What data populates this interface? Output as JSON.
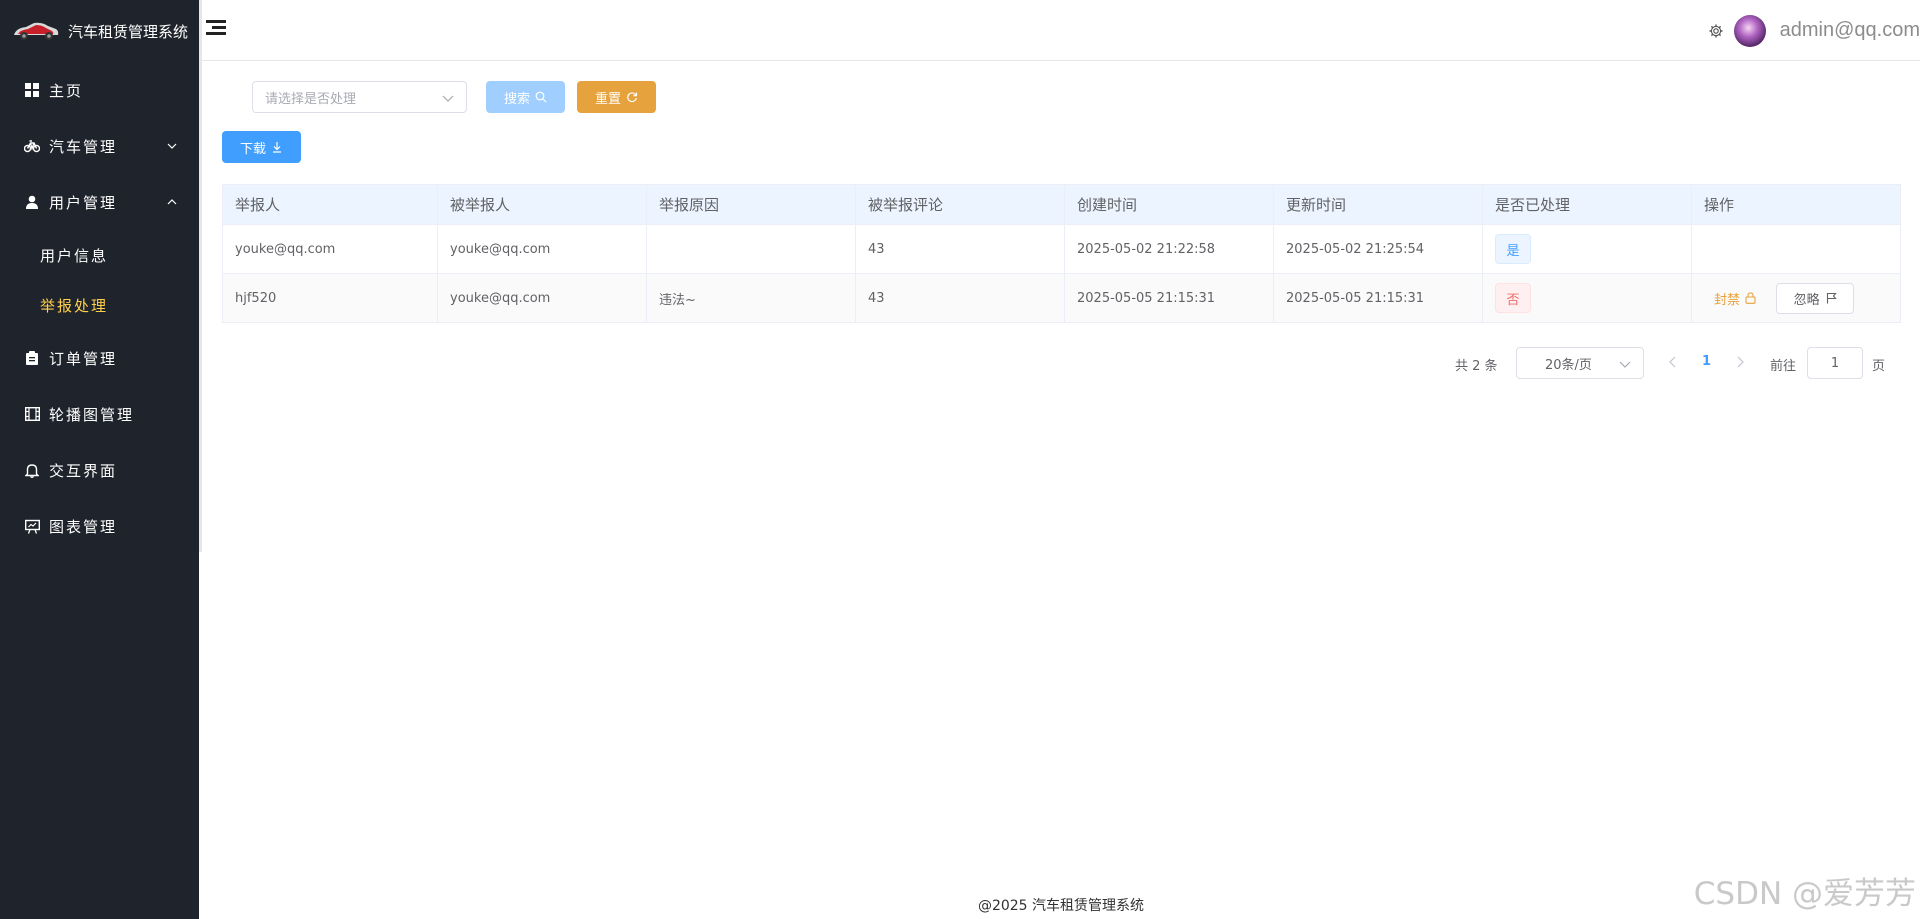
{
  "app": {
    "title": "汽车租赁管理系统"
  },
  "sidebar": {
    "items": [
      {
        "label": "主页",
        "icon": "grid-icon"
      },
      {
        "label": "汽车管理",
        "icon": "bicycle-icon"
      },
      {
        "label": "用户管理",
        "icon": "user-icon",
        "expanded": true,
        "children": [
          {
            "label": "用户信息"
          },
          {
            "label": "举报处理",
            "active": true
          }
        ]
      },
      {
        "label": "订单管理",
        "icon": "clipboard-icon"
      },
      {
        "label": "轮播图管理",
        "icon": "film-icon"
      },
      {
        "label": "交互界面",
        "icon": "bell-icon"
      },
      {
        "label": "图表管理",
        "icon": "presentation-icon"
      }
    ],
    "active_color": "#ffd04b",
    "background": "#1f232b"
  },
  "header": {
    "user_email": "admin@qq.com"
  },
  "filter": {
    "select_placeholder": "请选择是否处理",
    "search_label": "搜索",
    "reset_label": "重置",
    "download_label": "下载"
  },
  "table": {
    "columns": [
      "举报人",
      "被举报人",
      "举报原因",
      "被举报评论",
      "创建时间",
      "更新时间",
      "是否已处理",
      "操作"
    ],
    "rows": [
      {
        "reporter": "youke@qq.com",
        "reported": "youke@qq.com",
        "reason": "",
        "comment": "43",
        "created": "2025-05-02 21:22:58",
        "updated": "2025-05-02 21:25:54",
        "handled": "是"
      },
      {
        "reporter": "hjf520",
        "reported": "youke@qq.com",
        "reason": "违法~",
        "comment": "43",
        "created": "2025-05-05 21:15:31",
        "updated": "2025-05-05 21:15:31",
        "handled": "否",
        "actions": {
          "ban": "封禁",
          "ignore": "忽略"
        }
      }
    ]
  },
  "pagination": {
    "total_text": "共 2 条",
    "page_size": "20条/页",
    "current_page": "1",
    "goto_label": "前往",
    "goto_value": "1",
    "page_suffix": "页"
  },
  "footer": {
    "text": "@2025 汽车租赁管理系统"
  },
  "watermark": "CSDN @爱芳芳",
  "colors": {
    "primary": "#409eff",
    "warning": "#e6a23c",
    "danger": "#f56c6c",
    "header_bg": "#ecf5ff"
  }
}
